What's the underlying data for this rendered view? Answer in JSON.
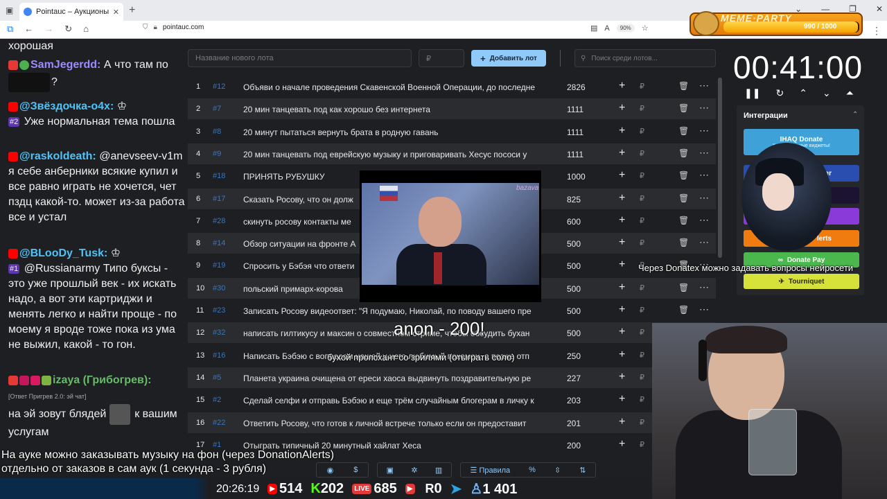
{
  "browser": {
    "tab_title": "Pointauc – Аукционы, лотереи",
    "url": "pointauc.com",
    "zoom": "90%"
  },
  "meme_party": {
    "title": "MEME·PARTY",
    "count": "990 / 1000",
    "progress": 0.99
  },
  "chat": [
    {
      "text": "хорошая"
    },
    {
      "nick": "SamJegerdd:",
      "nick_color": "#9b8cff",
      "text": "А что там по",
      "tail": "?"
    },
    {
      "nick": "@Звёздочка-о4х:",
      "nick_color": "#4fc3f7",
      "badge": "#2",
      "text": "Уже нормальная тема пошла"
    },
    {
      "nick": "@raskoldeath:",
      "nick_color": "#4fc3f7",
      "text": "@anevseev-v1m я себе анберники всякие купил и все равно играть не хочется, чет пздц какой-то. может из-за работа все и устал"
    },
    {
      "nick": "@BLooDy_Tusk:",
      "nick_color": "#4fc3f7",
      "badge": "#1",
      "text": "@Russianarmy Типо буксы - это уже прошлый век - их искать надо, а вот эти картриджи и менять легко и найти проще - по моему я вроде тоже пока из ума не выжил, какой - то гон."
    },
    {
      "nick": "izaya (Грибогрев):",
      "nick_color": "#66bb6a",
      "reply": "[Ответ Пригрев 2.0: эй чат]",
      "text": "на эй зовут блядей",
      "tail": "к вашим услугам"
    }
  ],
  "auction": {
    "name_placeholder": "Название нового лота",
    "price_placeholder": "₽",
    "add_button": "Добавить лот",
    "search_placeholder": "Поиск среди лотов...",
    "currency": "₽",
    "lots": [
      {
        "n": "1",
        "id": "#12",
        "name": "Объяви о начале проведения Скавенской Военной Операции, до последне",
        "amount": "2826"
      },
      {
        "n": "2",
        "id": "#7",
        "name": "20 мин танцевать под как хорошо без интернета",
        "amount": "1111"
      },
      {
        "n": "3",
        "id": "#8",
        "name": "20 минут пытаться вернуть брата в родную гавань",
        "amount": "1111"
      },
      {
        "n": "4",
        "id": "#9",
        "name": "20 мин танцевать под еврейскую музыку и приговаривать Хесус пососи у",
        "amount": "1111"
      },
      {
        "n": "5",
        "id": "#18",
        "name": "ПРИНЯТЬ РУБУШКУ",
        "amount": "1000"
      },
      {
        "n": "6",
        "id": "#17",
        "name": "Сказать Росову, что он долж",
        "amount": "825"
      },
      {
        "n": "7",
        "id": "#28",
        "name": "скинуть росову контакты ме",
        "amount": "600"
      },
      {
        "n": "8",
        "id": "#14",
        "name": "Обзор ситуации на фронте А",
        "amount": "500"
      },
      {
        "n": "9",
        "id": "#19",
        "name": "Спросить у Бэбэя что ответи",
        "amount": "500"
      },
      {
        "n": "10",
        "id": "#30",
        "name": "польский примарх-корова",
        "amount": "500"
      },
      {
        "n": "11",
        "id": "#23",
        "name": "Записать Росову видеоответ: \"Я подумаю, Николай, по поводу вашего пре",
        "amount": "500"
      },
      {
        "n": "12",
        "id": "#32",
        "name": "написать гилтикусу и максин о совместном стриме, чтобы обсудить бухан",
        "amount": "500"
      },
      {
        "n": "13",
        "id": "#16",
        "name": "Написать Бэбэю с вопросом нашей у него любимый покемон, а позже отп",
        "amount": "250"
      },
      {
        "n": "14",
        "id": "#5",
        "name": "Планета украина очищена от ереси хаоса выдвинуть поздравительную ре",
        "amount": "227"
      },
      {
        "n": "15",
        "id": "#2",
        "name": "Сделай селфи и отправь Бэбэю и еще трём случайным блогерам в личку к",
        "amount": "203"
      },
      {
        "n": "16",
        "id": "#22",
        "name": "Ответить Росову, что готов к личной встрече только если он предоставит",
        "amount": "201"
      },
      {
        "n": "17",
        "id": "#1",
        "name": "Отыграть типичный 20 минутный хайлат Хеса",
        "amount": "200"
      }
    ]
  },
  "timer": {
    "value": "00:41:00"
  },
  "integrations": {
    "title": "Интеграции",
    "ihaq_label": "IHAQ Donate",
    "ihaq_sub": "К... уникальные виджеты!",
    "btn2_label": "er",
    "btn5_label": "lerts",
    "donatepay_label": "Donate Pay",
    "tourniquet_label": "Tourniquet"
  },
  "video": {
    "logo": "bazava"
  },
  "overlays": {
    "anon": "anon - 200!",
    "anon_sub": "бухой пропсхант со зрилями (отыграть соло)",
    "donatex": "Через Donatex можно задавать вопросы нейросети",
    "bottom_line1": "На ауке можно заказывать музыку на фон (через DonationAlerts)",
    "bottom_line2": "отдельно от заказов в сам аук (1 секунда - 3 рубля)"
  },
  "toolbar": {
    "rules_label": "Правила"
  },
  "stream_status": {
    "time": "20:26:19",
    "youtube": "514",
    "kick": "202",
    "vk": "685",
    "rumble": "0",
    "viewers": "1 401",
    "colors": {
      "youtube": "#ff0000",
      "kick": "#53fc18",
      "vk": "#e03a3a",
      "telegram": "#2aa3e0",
      "viewers": "#6fb6ff"
    }
  }
}
